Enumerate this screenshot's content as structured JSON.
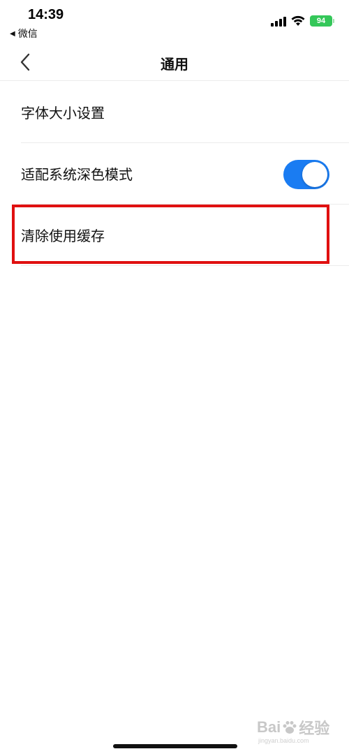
{
  "status_bar": {
    "time": "14:39",
    "back_app_label": "微信",
    "battery_level": "94"
  },
  "nav_bar": {
    "title": "通用"
  },
  "settings": {
    "items": [
      {
        "label": "字体大小设置"
      },
      {
        "label": "适配系统深色模式",
        "toggle_on": true
      },
      {
        "label": "清除使用缓存"
      }
    ]
  },
  "watermark": {
    "text_a": "Bai",
    "text_b": "经验",
    "sub": "jingyan.baidu.com"
  },
  "colors": {
    "toggle_on": "#1a7cf2",
    "battery": "#34c759",
    "highlight": "#e01010"
  }
}
